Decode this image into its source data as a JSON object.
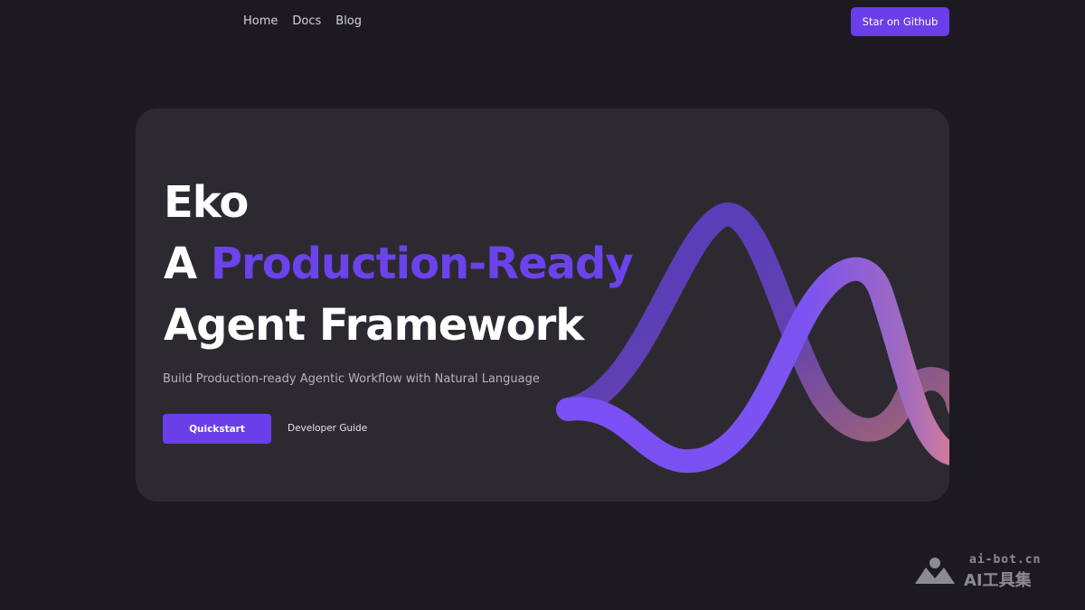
{
  "nav": {
    "links": [
      "Home",
      "Docs",
      "Blog"
    ],
    "cta_label": "Star on Github"
  },
  "hero": {
    "title_line1": "Eko",
    "title_line2_prefix": "A ",
    "title_line2_accent": "Production-Ready",
    "title_line3": "Agent Framework",
    "subtitle": "Build Production-ready Agentic Workflow with Natural Language",
    "primary_button": "Quickstart",
    "secondary_link": "Developer Guide"
  },
  "watermark": {
    "domain": "ai-bot.cn",
    "name": "AI工具集"
  },
  "colors": {
    "background": "#1c1a20",
    "card": "#2c2a30",
    "accent": "#6a3ee8",
    "wave_end": "#e0828e"
  }
}
